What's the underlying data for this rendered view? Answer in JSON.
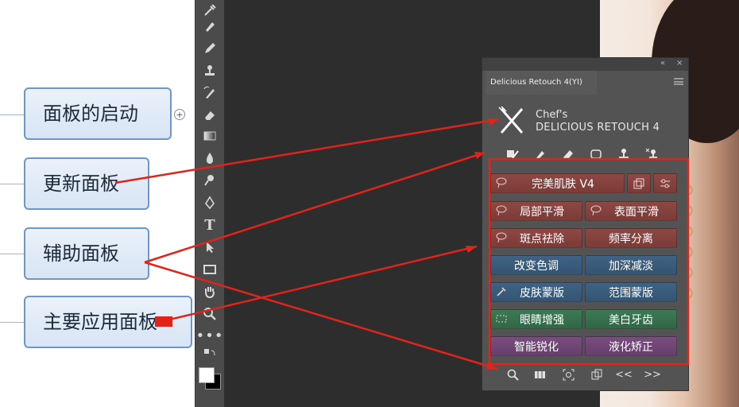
{
  "mindmap": {
    "nodes": [
      {
        "label": "面板的启动"
      },
      {
        "label": "更新面板"
      },
      {
        "label": "辅助面板"
      },
      {
        "label": "主要应用面板"
      }
    ],
    "expand_symbol": "+"
  },
  "toolbar": {
    "tools": [
      "eyedropper-icon",
      "brush-icon",
      "pencil-icon",
      "stamp-icon",
      "history-brush-icon",
      "eraser-icon",
      "gradient-icon",
      "blur-icon",
      "dodge-icon",
      "pen-icon",
      "type-icon",
      "path-select-icon",
      "rectangle-icon",
      "hand-icon",
      "zoom-icon",
      "more-icon"
    ],
    "type_tool_glyph": "T",
    "more_glyph": "•••"
  },
  "panel": {
    "tab_title": "Delicious Retouch 4(YI)",
    "collapse_glyph": "«",
    "close_glyph": "×",
    "logo_line1": "Chef's",
    "logo_line2": "DELICIOUS RETOUCH 4",
    "top_tools": [
      "mask-icon",
      "brush-icon",
      "eraser-icon",
      "selection-icon",
      "stamp-icon",
      "stamp-cross-icon"
    ],
    "buttons": {
      "perfect_skin": "完美肌肤 V4",
      "local_smooth": "局部平滑",
      "surface_smooth": "表面平滑",
      "spot_removal": "斑点祛除",
      "frequency_separation": "频率分离",
      "change_tone": "改变色调",
      "dodge_burn": "加深减淡",
      "skin_mask": "皮肤蒙版",
      "range_mask": "范围蒙版",
      "eye_enhance": "眼睛增强",
      "teeth_whiten": "美白牙齿",
      "smart_sharpen": "智能锐化",
      "liquify": "液化矫正"
    },
    "footer": {
      "icons": [
        "zoom-icon",
        "compare-icon",
        "view-icon",
        "duplicate-icon",
        "prev-icon",
        "next-icon"
      ],
      "prev_glyph": "<<",
      "next_glyph": ">>"
    }
  },
  "colors": {
    "annotation_red": "#e0241b",
    "mindmap_border": "#6d97c9",
    "button_red": "#8e4844",
    "button_blue": "#3f6385",
    "button_green": "#3c7a55",
    "button_purple": "#7a4d80"
  }
}
